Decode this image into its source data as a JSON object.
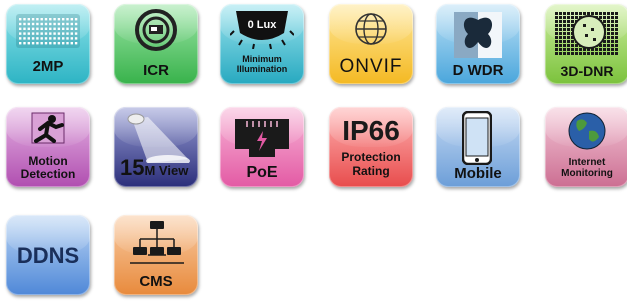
{
  "features": [
    {
      "label": "2MP",
      "icon": "dot-grid-sensor-icon"
    },
    {
      "label": "ICR",
      "icon": "camera-lens-icon"
    },
    {
      "label_top": "0 Lux",
      "label_line1": "Minimum",
      "label_line2": "Illumination",
      "icon": "ir-led-array-icon"
    },
    {
      "label": "ONVIF",
      "icon": "globe-icon"
    },
    {
      "label": "D WDR",
      "icon": "butterfly-icon"
    },
    {
      "label": "3D-DNR",
      "icon": "noise-grid-icon"
    },
    {
      "label_line1": "Motion",
      "label_line2": "Detection",
      "icon": "running-man-icon"
    },
    {
      "label_big": "15",
      "label_small": "M View",
      "icon": "spotlight-icon"
    },
    {
      "label": "PoE",
      "icon": "ethernet-port-icon"
    },
    {
      "label_big": "IP66",
      "label_line1": "Protection",
      "label_line2": "Rating",
      "icon": "ip66-icon"
    },
    {
      "label": "Mobile",
      "icon": "smartphone-icon"
    },
    {
      "label_line1": "Internet",
      "label_line2": "Monitoring",
      "icon": "earth-globe-icon"
    },
    {
      "label": "DDNS",
      "icon": "ddns-icon"
    },
    {
      "label": "CMS",
      "icon": "network-tree-icon"
    }
  ]
}
